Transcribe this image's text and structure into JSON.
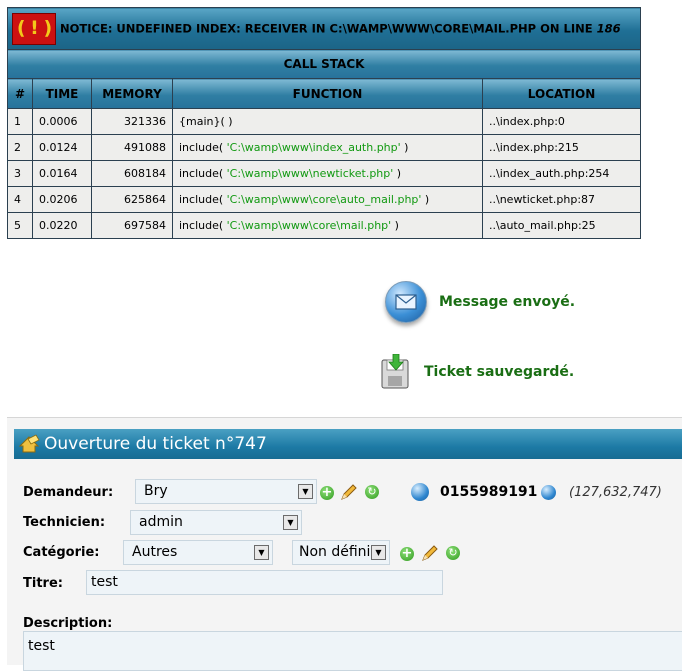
{
  "notice": {
    "badge": "( ! )",
    "message": "NOTICE: UNDEFINED INDEX: RECEIVER IN C:\\WAMP\\WWW\\CORE\\MAIL.PHP ON LINE",
    "line": "186",
    "call_stack_label": "CALL STACK",
    "columns": [
      "#",
      "TIME",
      "MEMORY",
      "FUNCTION",
      "LOCATION"
    ],
    "rows": [
      {
        "n": "1",
        "time": "0.0006",
        "memory": "321336",
        "func": "{main}( )",
        "arg": "",
        "func_end": "",
        "location": "..\\index.php:0"
      },
      {
        "n": "2",
        "time": "0.0124",
        "memory": "491088",
        "func": "include( ",
        "arg": "'C:\\wamp\\www\\index_auth.php'",
        "func_end": " )",
        "location": "..\\index.php:215"
      },
      {
        "n": "3",
        "time": "0.0164",
        "memory": "608184",
        "func": "include( ",
        "arg": "'C:\\wamp\\www\\newticket.php'",
        "func_end": " )",
        "location": "..\\index_auth.php:254"
      },
      {
        "n": "4",
        "time": "0.0206",
        "memory": "625864",
        "func": "include( ",
        "arg": "'C:\\wamp\\www\\core\\auto_mail.php'",
        "func_end": " )",
        "location": "..\\newticket.php:87"
      },
      {
        "n": "5",
        "time": "0.0220",
        "memory": "697584",
        "func": "include( ",
        "arg": "'C:\\wamp\\www\\core\\mail.php'",
        "func_end": " )",
        "location": "..\\auto_mail.php:25"
      }
    ]
  },
  "messages": {
    "sent": "Message envoyé.",
    "saved": "Ticket sauvegardé."
  },
  "ticket": {
    "title": "Ouverture du ticket n°747",
    "labels": {
      "requester": "Demandeur:",
      "technician": "Technicien:",
      "category": "Catégorie:",
      "title": "Titre:",
      "description": "Description:"
    },
    "requester_value": "Bry",
    "phone": "0155989191",
    "ip": "(127,632,747)",
    "technician_value": "admin",
    "category_value": "Autres",
    "subcategory_value": "Non défini",
    "title_value": "test",
    "description_value": "test"
  },
  "icons": [
    "error-icon",
    "mail-icon",
    "save-icon",
    "ticket-icon",
    "add-icon",
    "edit-icon",
    "refresh-icon",
    "phone-icon",
    "globe-icon"
  ]
}
